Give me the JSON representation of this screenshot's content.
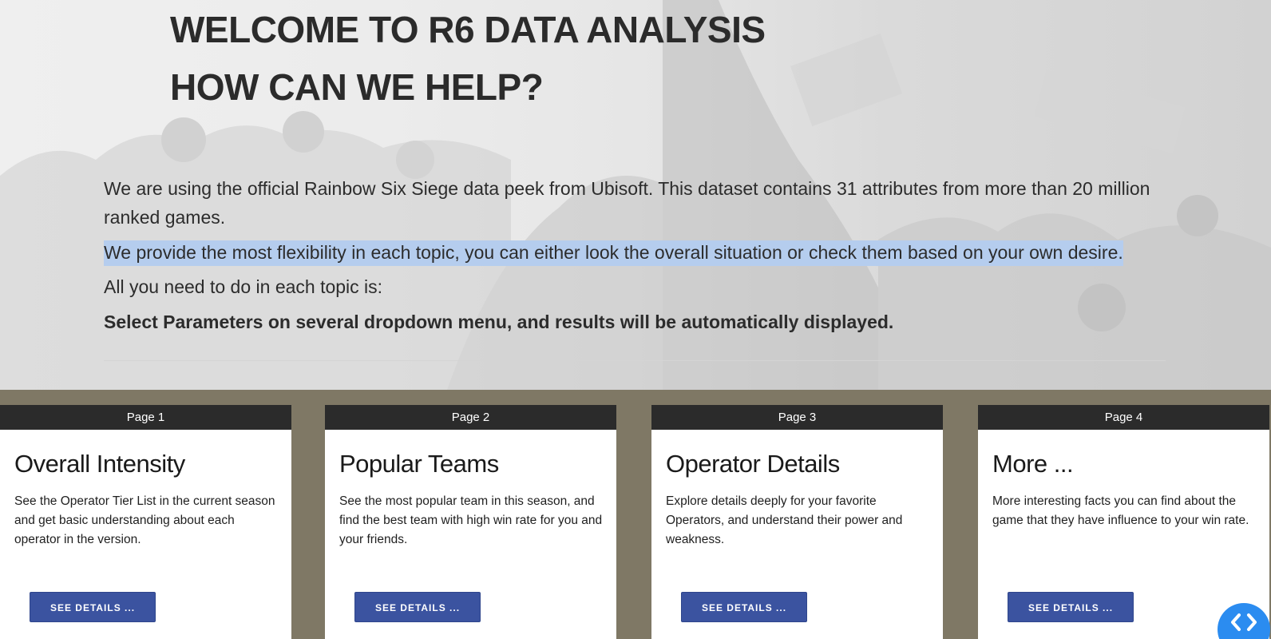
{
  "hero": {
    "title_line1": "WELCOME TO R6 DATA ANALYSIS",
    "title_line2": "HOW CAN WE HELP?",
    "paragraph1": "We are using the official Rainbow Six Siege data peek from Ubisoft. This dataset contains 31 attributes from more than 20 million ranked games.",
    "paragraph2": "We provide the most flexibility in each topic, you can either look the overall situation or check them based on your own desire.",
    "paragraph3": "All you need to do in each topic is:",
    "paragraph4": "Select Parameters on several dropdown menu, and results will be automatically displayed."
  },
  "cards": [
    {
      "page_label": "Page 1",
      "title": "Overall Intensity",
      "description": "See the Operator Tier List in the current season and get basic understanding about each operator in the version.",
      "button_label": "SEE DETAILS ..."
    },
    {
      "page_label": "Page 2",
      "title": "Popular Teams",
      "description": "See the most popular team in this season, and find the best team with high win rate for you and your friends.",
      "button_label": "SEE DETAILS ..."
    },
    {
      "page_label": "Page 3",
      "title": "Operator Details",
      "description": "Explore details deeply for your favorite Operators, and understand their power and weakness.",
      "button_label": "SEE DETAILS ..."
    },
    {
      "page_label": "Page 4",
      "title": "More ...",
      "description": "More interesting facts you can find about the game that they have influence to your win rate.",
      "button_label": "SEE DETAILS ..."
    }
  ],
  "colors": {
    "band_background": "#7f7865",
    "card_header": "#2b2b2b",
    "button": "#3b53a0",
    "highlight": "#b5cdee",
    "nav_button": "#2b8cf0"
  },
  "icons": {
    "nav": "code-brackets-icon"
  }
}
